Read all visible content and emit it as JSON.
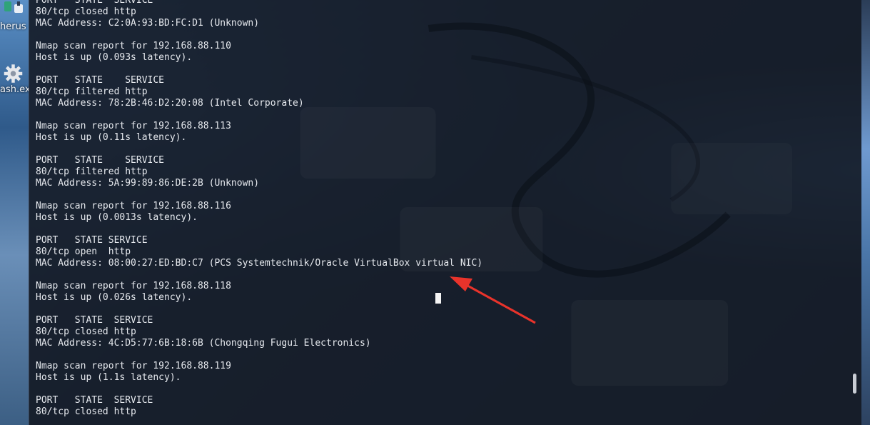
{
  "desktop": {
    "icons": [
      {
        "label": "herus",
        "icon": "app-icon"
      },
      {
        "label": "ash.ex",
        "icon": "gear-icon"
      }
    ]
  },
  "terminal": {
    "lines": [
      "PORT   STATE  SERVICE",
      "80/tcp closed http",
      "MAC Address: C2:0A:93:BD:FC:D1 (Unknown)",
      "",
      "Nmap scan report for 192.168.88.110",
      "Host is up (0.093s latency).",
      "",
      "PORT   STATE    SERVICE",
      "80/tcp filtered http",
      "MAC Address: 78:2B:46:D2:20:08 (Intel Corporate)",
      "",
      "Nmap scan report for 192.168.88.113",
      "Host is up (0.11s latency).",
      "",
      "PORT   STATE    SERVICE",
      "80/tcp filtered http",
      "MAC Address: 5A:99:89:86:DE:2B (Unknown)",
      "",
      "Nmap scan report for 192.168.88.116",
      "Host is up (0.0013s latency).",
      "",
      "PORT   STATE SERVICE",
      "80/tcp open  http",
      "MAC Address: 08:00:27:ED:BD:C7 (PCS Systemtechnik/Oracle VirtualBox virtual NIC)",
      "",
      "Nmap scan report for 192.168.88.118",
      "Host is up (0.026s latency).",
      "",
      "PORT   STATE  SERVICE",
      "80/tcp closed http",
      "MAC Address: 4C:D5:77:6B:18:6B (Chongqing Fugui Electronics)",
      "",
      "Nmap scan report for 192.168.88.119",
      "Host is up (1.1s latency).",
      "",
      "PORT   STATE  SERVICE",
      "80/tcp closed http"
    ]
  },
  "annotation": {
    "color": "#e8332b",
    "icon": "red-arrow-icon"
  },
  "colors": {
    "terminal_text": "#e6e9ee",
    "terminal_bg": "#161c28"
  }
}
